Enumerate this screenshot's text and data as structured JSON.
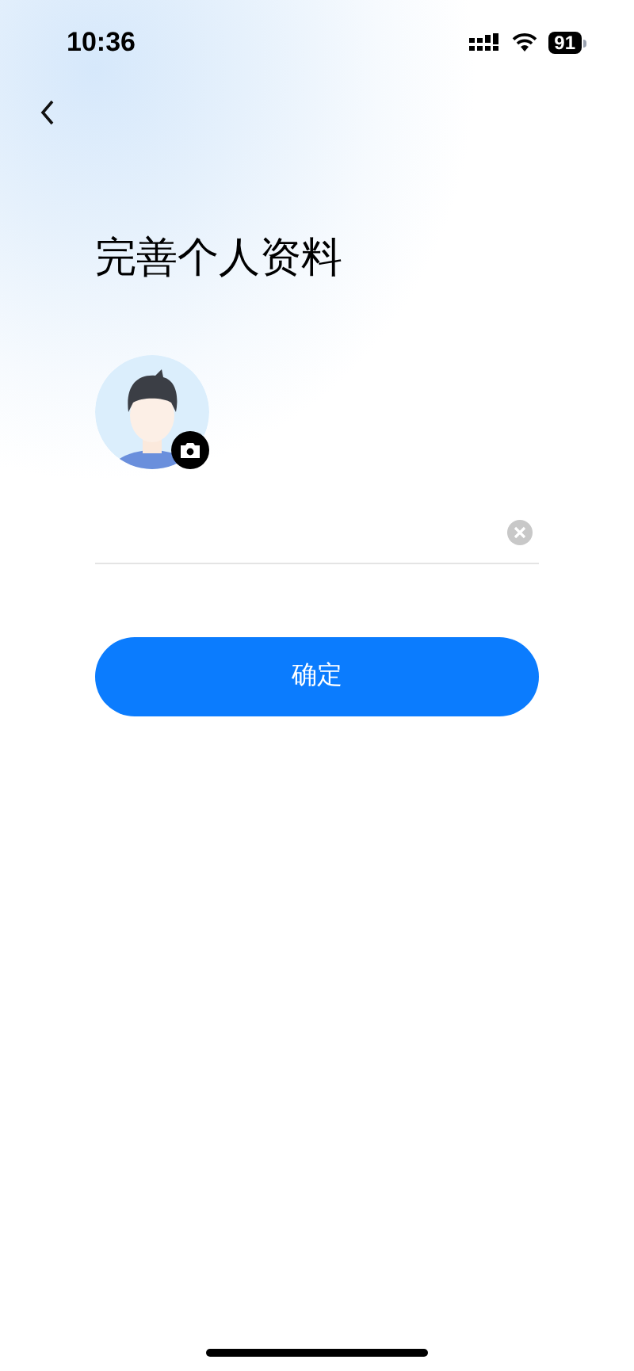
{
  "status_bar": {
    "time": "10:36",
    "battery": "91"
  },
  "title": "完善个人资料",
  "confirm_button": {
    "label": "确定"
  }
}
